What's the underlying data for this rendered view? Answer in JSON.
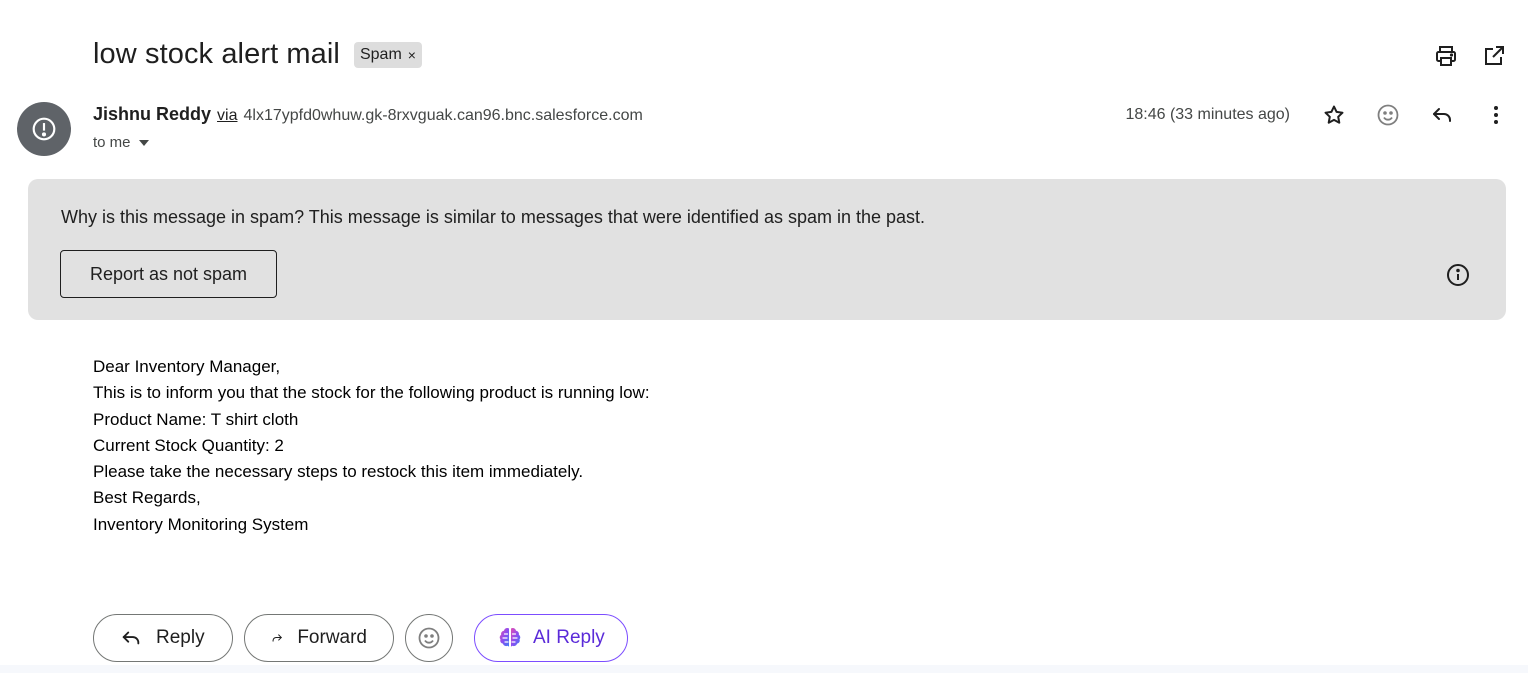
{
  "subject": "low stock alert mail",
  "labels": {
    "spam": "Spam",
    "remove_glyph": "×"
  },
  "sender": {
    "name": "Jishnu Reddy",
    "via_label": "via",
    "via_domain": "4lx17ypfd0whuw.gk-8rxvguak.can96.bnc.salesforce.com",
    "to_label": "to me"
  },
  "timestamp": "18:46 (33 minutes ago)",
  "spam_banner": {
    "question": "Why is this message in spam?",
    "explanation": " This message is similar to messages that were identified as spam in the past.",
    "button_label": "Report as not spam"
  },
  "body_lines": [
    "Dear Inventory Manager,",
    "This is to inform you that the stock for the following product is running low:",
    "Product Name: T shirt cloth",
    "Current Stock Quantity: 2",
    "Please take the necessary steps to restock this item immediately.",
    "Best Regards,",
    "Inventory Monitoring System"
  ],
  "actions": {
    "reply": "Reply",
    "forward": "Forward",
    "ai_reply": "AI Reply"
  },
  "icons": {
    "print": "print-icon",
    "open_new": "open-in-new-window-icon",
    "avatar": "spam-warning-icon",
    "star": "star-icon",
    "emoji": "emoji-smile-icon",
    "reply": "reply-icon",
    "more": "more-vert-icon",
    "info": "info-icon",
    "forward": "forward-icon",
    "ai": "ai-brain-icon"
  },
  "colors": {
    "banner_bg": "#e1e1e1",
    "avatar_bg": "#5f6368",
    "ai_accent": "#7c4dff"
  }
}
